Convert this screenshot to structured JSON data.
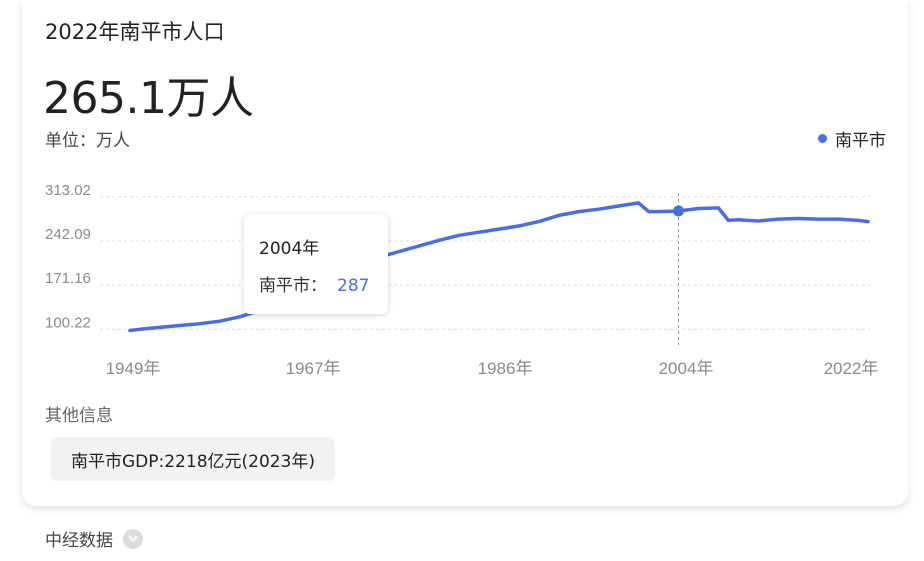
{
  "header": {
    "title": "2022年南平市人口",
    "big_value": "265.1万人",
    "unit": "单位：万人",
    "legend": "南平市"
  },
  "tooltip": {
    "year": "2004年",
    "label": "南平市：",
    "value": "287"
  },
  "other_info": {
    "label": "其他信息",
    "chip": "南平市GDP:2218亿元(2023年)"
  },
  "source": {
    "label": "中经数据",
    "icon": "chevron-down-icon"
  },
  "colors": {
    "line": "#4a6ee0",
    "grid": "#dddddd",
    "tick_text": "#8a8a8a"
  },
  "chart_data": {
    "type": "line",
    "series": [
      {
        "name": "南平市",
        "x": [
          1949,
          1950,
          1952,
          1954,
          1956,
          1958,
          1960,
          1962,
          1964,
          1966,
          1968,
          1970,
          1972,
          1974,
          1976,
          1978,
          1980,
          1982,
          1984,
          1986,
          1988,
          1990,
          1992,
          1994,
          1996,
          1998,
          2000,
          2001,
          2002,
          2004,
          2006,
          2008,
          2009,
          2010,
          2012,
          2014,
          2016,
          2018,
          2020,
          2022,
          2023
        ],
        "values": [
          95,
          97,
          100,
          103,
          106,
          110,
          117,
          127,
          140,
          155,
          172,
          188,
          200,
          213,
          222,
          231,
          240,
          248,
          253,
          258,
          263,
          270,
          280,
          286,
          290,
          295,
          300,
          286,
          286,
          287,
          291,
          292,
          272,
          273,
          271,
          274,
          275,
          274,
          274,
          272,
          270
        ]
      }
    ],
    "x_ticks": [
      "1949年",
      "1967年",
      "1986年",
      "2004年",
      "2022年"
    ],
    "y_ticks": [
      "313.02",
      "242.09",
      "171.16",
      "100.22"
    ],
    "ylim": [
      91.0,
      324.0
    ],
    "xlim": [
      1948,
      2023
    ],
    "highlight": {
      "x": 2004,
      "value": 287
    },
    "grid": true,
    "legend_position": "top-right"
  }
}
